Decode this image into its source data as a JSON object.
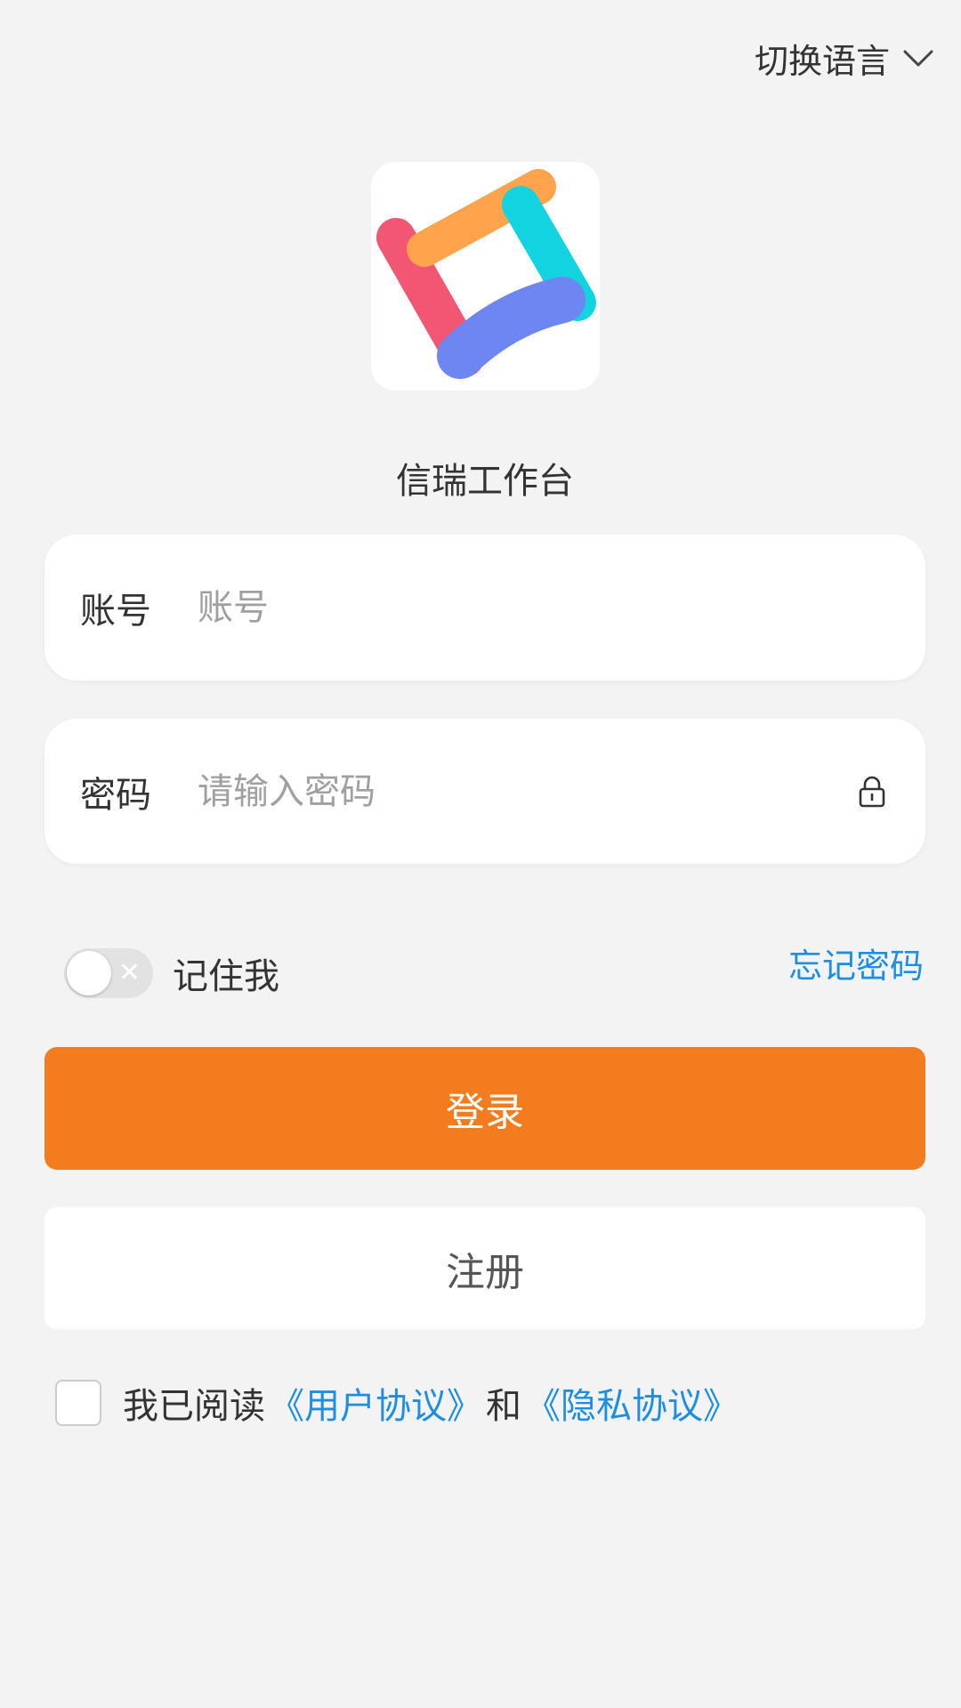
{
  "header": {
    "language_switch": "切换语言"
  },
  "app": {
    "name": "信瑞工作台"
  },
  "account": {
    "label": "账号",
    "placeholder": "账号"
  },
  "password": {
    "label": "密码",
    "placeholder": "请输入密码"
  },
  "remember": {
    "label": "记住我",
    "enabled": false
  },
  "forgot_password": "忘记密码",
  "buttons": {
    "login": "登录",
    "register": "注册"
  },
  "agreement": {
    "prefix": "我已阅读",
    "user_agreement": "《用户协议》",
    "conjunction": "和",
    "privacy_agreement": "《隐私协议》",
    "checked": false
  },
  "colors": {
    "background": "#f3f3f3",
    "primary": "#f37c1f",
    "link": "#1e8ee0",
    "logo_red": "#f25672",
    "logo_orange": "#ffa34d",
    "logo_cyan": "#12d3e0",
    "logo_blue": "#6d86f2"
  },
  "icons": {
    "language": "chevron-down-icon",
    "password": "lock-icon",
    "toggle": "close-icon"
  }
}
